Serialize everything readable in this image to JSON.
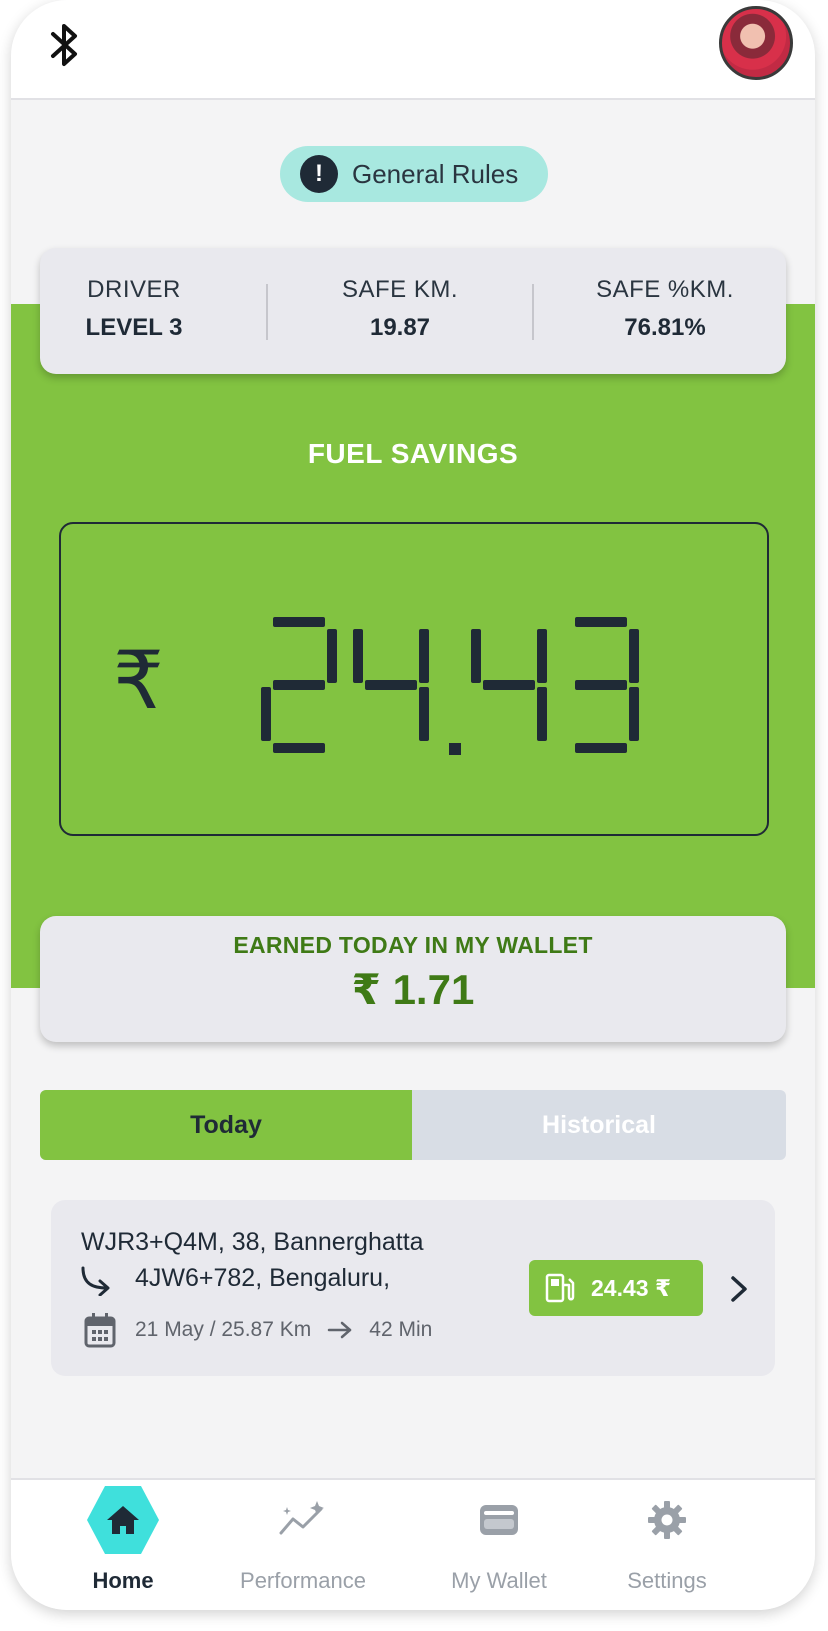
{
  "header": {
    "bluetooth_icon": "bluetooth-icon",
    "avatar": "user-avatar"
  },
  "rules": {
    "label": "General Rules",
    "icon": "exclamation-icon"
  },
  "stats": [
    {
      "label": "DRIVER",
      "value": "LEVEL 3"
    },
    {
      "label": "SAFE KM.",
      "value": "19.87"
    },
    {
      "label": "SAFE %KM.",
      "value": "76.81%"
    }
  ],
  "fuel": {
    "title": "FUEL SAVINGS",
    "currency": "₹",
    "amount": "24.43"
  },
  "wallet": {
    "label": "EARNED TODAY IN MY WALLET",
    "amount": "₹ 1.71"
  },
  "tabs": {
    "today": "Today",
    "historical": "Historical",
    "active": "today"
  },
  "trip": {
    "from": "WJR3+Q4M, 38, Bannerghatta",
    "to": "4JW6+782, Bengaluru,",
    "date_distance": "21 May / 25.87 Km",
    "duration": "42 Min",
    "fuel_saved": "24.43 ₹"
  },
  "nav": [
    {
      "label": "Home",
      "icon": "home-icon",
      "active": true
    },
    {
      "label": "Performance",
      "icon": "performance-icon",
      "active": false
    },
    {
      "label": "My Wallet",
      "icon": "wallet-icon",
      "active": false
    },
    {
      "label": "Settings",
      "icon": "gear-icon",
      "active": false
    }
  ],
  "colors": {
    "green": "#82c341",
    "dark_green": "#3f7a16",
    "navy": "#1f2a36",
    "teal": "#3fe0dc",
    "pill": "#a8e8e0"
  }
}
